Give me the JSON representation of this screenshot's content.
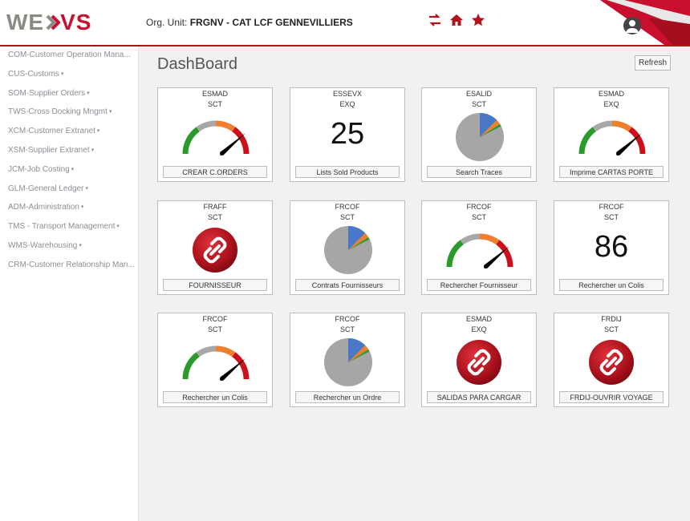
{
  "header": {
    "logo_left": "WE",
    "logo_right": "VS",
    "org_label": "Org. Unit:",
    "org_value": "FRGNV - CAT LCF GENNEVILLIERS",
    "icons": [
      "swap-arrows-icon",
      "home-icon",
      "star-icon",
      "user-avatar-icon"
    ],
    "accent_color": "#b1141b"
  },
  "sidebar": {
    "items": [
      {
        "label": "COM-Customer Operation Mana...",
        "caret": false
      },
      {
        "label": "CUS-Customs",
        "caret": true
      },
      {
        "label": "SOM-Supplier Orders",
        "caret": true
      },
      {
        "label": "TWS-Cross Docking Mngmt",
        "caret": true
      },
      {
        "label": "XCM-Customer Extranet",
        "caret": true
      },
      {
        "label": "XSM-Supplier Extranet",
        "caret": true
      },
      {
        "label": "JCM-Job Costing",
        "caret": true
      },
      {
        "label": "GLM-General Ledger",
        "caret": true
      },
      {
        "label": "ADM-Administration",
        "caret": true
      },
      {
        "label": "TMS - Transport Management",
        "caret": true
      },
      {
        "label": "WMS-Warehousing",
        "caret": true
      },
      {
        "label": "CRM-Customer Relationship Man...",
        "caret": false
      }
    ]
  },
  "main": {
    "title": "DashBoard",
    "refresh_label": "Refresh",
    "cards": [
      {
        "code": "ESMAD",
        "type": "SCT",
        "visual": "gauge",
        "button": "CREAR C.ORDERS"
      },
      {
        "code": "ESSEVX",
        "type": "EXQ",
        "visual": "number",
        "value": "25",
        "button": "Lists Sold Products"
      },
      {
        "code": "ESALID",
        "type": "SCT",
        "visual": "pie",
        "button": "Search Traces"
      },
      {
        "code": "ESMAD",
        "type": "EXQ",
        "visual": "gauge",
        "button": "Imprime CARTAS PORTE"
      },
      {
        "code": "FRAFF",
        "type": "SCT",
        "visual": "link",
        "button": "FOURNISSEUR"
      },
      {
        "code": "FRCOF",
        "type": "SCT",
        "visual": "pie",
        "button": "Contrats Fournisseurs"
      },
      {
        "code": "FRCOF",
        "type": "SCT",
        "visual": "gauge",
        "button": "Rechercher Fournisseur"
      },
      {
        "code": "FRCOF",
        "type": "SCT",
        "visual": "number",
        "value": "86",
        "button": "Rechercher un Colis"
      },
      {
        "code": "FRCOF",
        "type": "SCT",
        "visual": "gauge",
        "button": "Rechercher un Colis"
      },
      {
        "code": "FRCOF",
        "type": "SCT",
        "visual": "pie",
        "button": "Rechercher un Ordre"
      },
      {
        "code": "ESMAD",
        "type": "EXQ",
        "visual": "link",
        "button": "SALIDAS PARA CARGAR"
      },
      {
        "code": "FRDIJ",
        "type": "SCT",
        "visual": "link",
        "button": "FRDIJ-OUVRIR VOYAGE"
      }
    ]
  }
}
